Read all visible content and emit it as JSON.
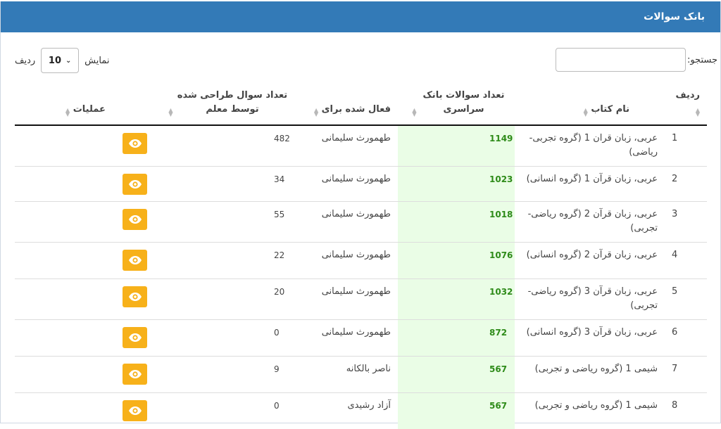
{
  "panel": {
    "title": "بانک سوالات"
  },
  "search": {
    "label": "جستجو:",
    "value": ""
  },
  "length": {
    "prefix": "نمایش",
    "value": "10",
    "suffix": "ردیف"
  },
  "colors": {
    "header_bg": "#337ab7",
    "bank_col_bg": "#eafde6",
    "bank_text": "#2e8b19",
    "action_btn": "#f7b11a"
  },
  "table": {
    "headers": {
      "row": "ردیف",
      "book": "نام کتاب",
      "bank": "تعداد سوالات بانک سراسری",
      "active_for": "فعال شده برای",
      "teacher_count": "تعداد سوال طراحی شده توسط معلم",
      "ops": "عملیات"
    },
    "rows": [
      {
        "num": "1",
        "book": "عربی، زبان قران 1 (گروه تجربی-ریاضی)",
        "bank": "1149",
        "active_for": "طهمورث سلیمانی",
        "teacher_count": "482",
        "action_icon": "eye-icon"
      },
      {
        "num": "2",
        "book": "عربی، زبان قرآن 1 (گروه انسانی)",
        "bank": "1023",
        "active_for": "طهمورث سلیمانی",
        "teacher_count": "34",
        "action_icon": "eye-icon"
      },
      {
        "num": "3",
        "book": "عربی، زبان قرآن 2 (گروه ریاضی-تجربی)",
        "bank": "1018",
        "active_for": "طهمورث سلیمانی",
        "teacher_count": "55",
        "action_icon": "eye-icon"
      },
      {
        "num": "4",
        "book": "عربی، زبان قرآن 2 (گروه انسانی)",
        "bank": "1076",
        "active_for": "طهمورث سلیمانی",
        "teacher_count": "22",
        "action_icon": "eye-icon"
      },
      {
        "num": "5",
        "book": "عربی، زبان قرآن 3 (گروه ریاضی-تجربی)",
        "bank": "1032",
        "active_for": "طهمورث سلیمانی",
        "teacher_count": "20",
        "action_icon": "eye-icon"
      },
      {
        "num": "6",
        "book": "عربی، زبان قرآن 3 (گروه انسانی)",
        "bank": "872",
        "active_for": "طهمورث سلیمانی",
        "teacher_count": "0",
        "action_icon": "eye-icon"
      },
      {
        "num": "7",
        "book": "شیمی 1 (گروه ریاضی و تجربی)",
        "bank": "567",
        "active_for": "ناصر بالکانه",
        "teacher_count": "9",
        "action_icon": "eye-icon"
      },
      {
        "num": "8",
        "book": "شیمی 1 (گروه ریاضی و تجربی)",
        "bank": "567",
        "active_for": "آزاد رشیدی",
        "teacher_count": "0",
        "action_icon": "eye-icon"
      }
    ]
  }
}
